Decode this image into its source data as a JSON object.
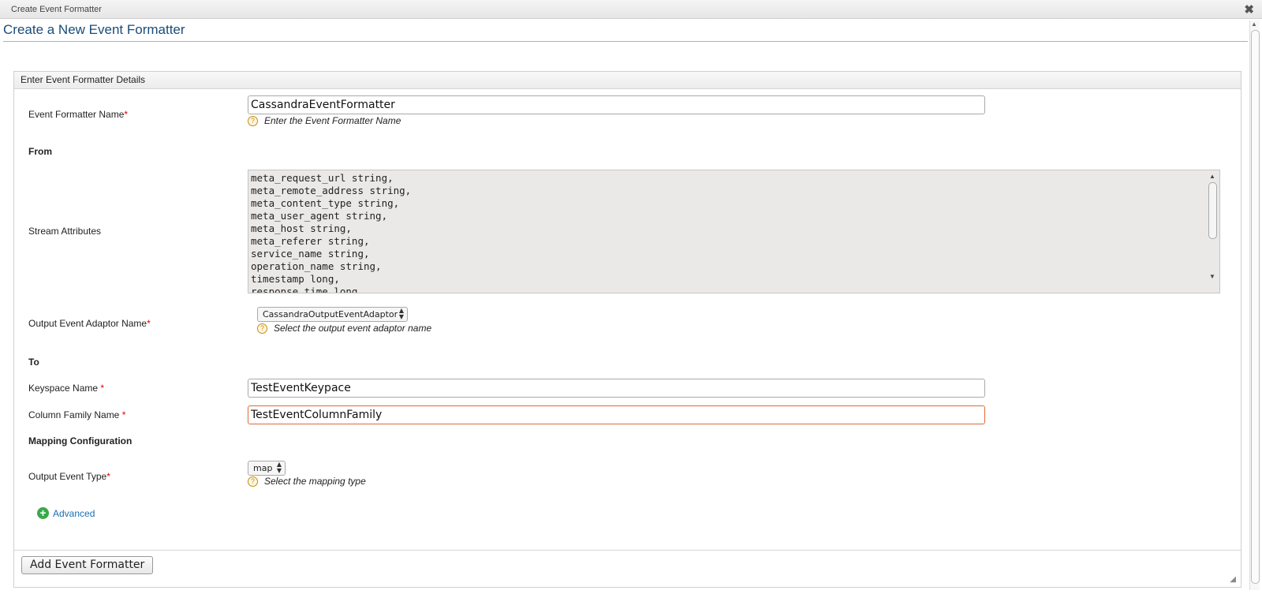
{
  "window": {
    "title": "Create Event Formatter",
    "close_symbol": "✖"
  },
  "page": {
    "heading": "Create a New Event Formatter"
  },
  "panel": {
    "title": "Enter Event Formatter Details"
  },
  "form": {
    "formatter_name": {
      "label": "Event Formatter Name",
      "required": "*",
      "value": "CassandraEventFormatter",
      "hint": "Enter the Event Formatter Name"
    },
    "from": {
      "section": "From",
      "stream_attributes_label": "Stream Attributes",
      "stream_attributes_text": "meta_request_url string,\nmeta_remote_address string,\nmeta_content_type string,\nmeta_user_agent string,\nmeta_host string,\nmeta_referer string,\nservice_name string,\noperation_name string,\ntimestamp long,\nresponse_time long"
    },
    "adaptor": {
      "label": "Output Event Adaptor Name",
      "required": "*",
      "selected": "CassandraOutputEventAdaptor",
      "hint": "Select the output event adaptor name"
    },
    "to": {
      "section": "To",
      "keyspace": {
        "label": "Keyspace Name",
        "required": "*",
        "value": "TestEventKeypace"
      },
      "column_family": {
        "label": "Column Family Name",
        "required": "*",
        "value": "TestEventColumnFamily"
      }
    },
    "mapping": {
      "section": "Mapping Configuration",
      "output_type": {
        "label": "Output Event Type",
        "required": "*",
        "selected": "map",
        "hint": "Select the mapping type"
      }
    },
    "advanced": {
      "label": "Advanced"
    }
  },
  "actions": {
    "submit_label": "Add Event Formatter"
  },
  "icons": {
    "help": "question-icon",
    "add": "plus-circle-icon",
    "close": "close-icon"
  },
  "colors": {
    "heading": "#1b4b7a",
    "focus_border": "#e06a3a",
    "required": "#dd0000",
    "add_icon": "#3aa84a",
    "link": "#1a6fb0"
  }
}
